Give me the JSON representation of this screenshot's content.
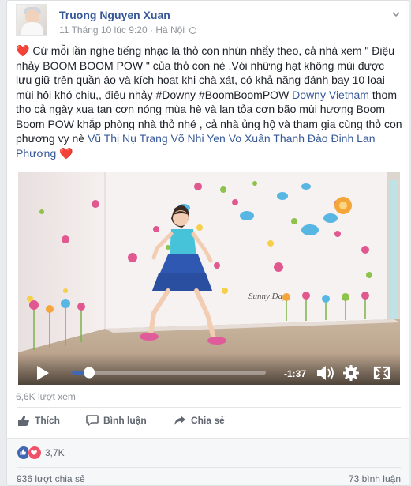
{
  "post": {
    "author": "Truong Nguyen Xuan",
    "timestamp": "11 Tháng 10 lúc 9:20",
    "separator": "·",
    "location": "Hà Nội",
    "text_parts": [
      {
        "t": "❤️",
        "style": "heart"
      },
      {
        "t": " Cứ mỗi lần nghe tiếng nhạc là thỏ con nhún nhẩy theo, cả nhà xem \" Điệu nhảy BOOM BOOM POW \" của thỏ con nè .Vói những hạt không mùi được lưu giữ trên quần áo và kích hoạt khi chà xát, có khả năng đánh bay 10 loại mùi hôi khó chịu,, điệu nhảy #Downy #BoomBoomPOW ",
        "style": "plain"
      },
      {
        "t": "Downy Vietnam",
        "style": "link"
      },
      {
        "t": " thom tho cả ngày xua tan cơn nóng mùa hè và lan tỏa cơn bão mùi hương Boom Boom POW khắp phòng nhà thỏ nhé , cả nhà ủng hộ và tham gia cùng thỏ con phương vy nè ",
        "style": "plain"
      },
      {
        "t": "Vũ Thị Nụ Trang",
        "style": "link"
      },
      {
        "t": " ",
        "style": "plain"
      },
      {
        "t": "Võ Nhi Yen",
        "style": "link"
      },
      {
        "t": " ",
        "style": "plain"
      },
      {
        "t": "Vo Xuân Thanh",
        "style": "link"
      },
      {
        "t": " ",
        "style": "plain"
      },
      {
        "t": "Đào Đinh Lan Phương",
        "style": "link"
      },
      {
        "t": " ",
        "style": "plain"
      },
      {
        "t": "❤️",
        "style": "heart"
      }
    ]
  },
  "video": {
    "time_remaining": "-1:37",
    "progress": 0.09,
    "wall_caption": "Sunny Day"
  },
  "views": "6,6K lượt xem",
  "actions": {
    "like": "Thích",
    "comment": "Bình luận",
    "share": "Chia sẻ"
  },
  "reactions": {
    "count": "3,7K",
    "types": [
      "like",
      "love"
    ],
    "like_color": "#4267b2",
    "love_color": "#f25268"
  },
  "shares_count": "936 lượt chia sẻ",
  "comments_count": "73 bình luận"
}
